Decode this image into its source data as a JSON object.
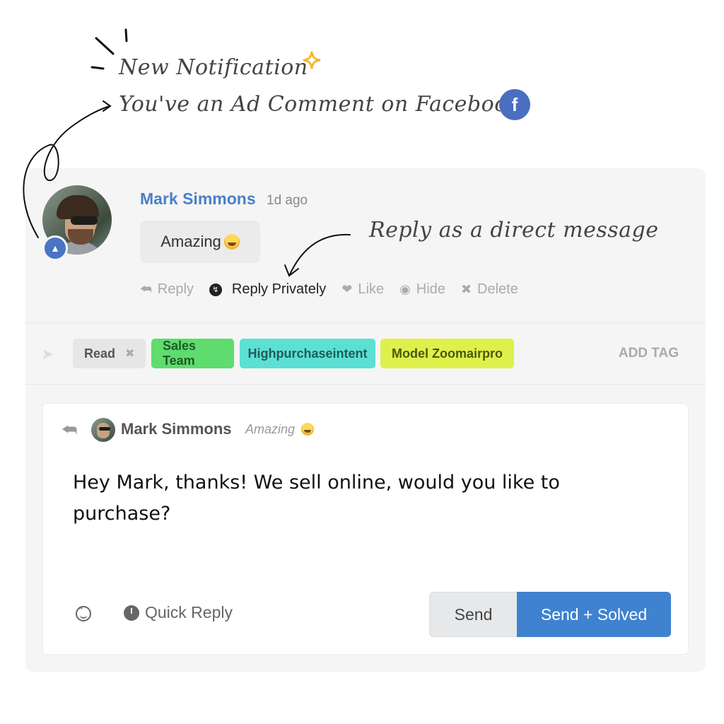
{
  "annotation": {
    "title": "New Notification",
    "subtitle": "You've an Ad Comment on Facebook",
    "platform_badge": "f",
    "reply_hint": "Reply as a direct message"
  },
  "comment": {
    "author": "Mark Simmons",
    "time_ago": "1d ago",
    "text": "Amazing",
    "emoji_icon": "star-struck-emoji",
    "avatar_badge_icon": "megaphone-icon",
    "actions": [
      {
        "label": "Reply",
        "icon": "reply-arrow-icon"
      },
      {
        "label": "Reply Privately",
        "icon": "messenger-icon"
      },
      {
        "label": "Like",
        "icon": "heart-icon"
      },
      {
        "label": "Hide",
        "icon": "eye-slash-icon"
      },
      {
        "label": "Delete",
        "icon": "x-icon"
      }
    ]
  },
  "tags": {
    "icon": "tag-icon",
    "items": [
      {
        "label": "Read",
        "removable": true,
        "color": "#e6e6e6"
      },
      {
        "label": "Sales Team",
        "color": "#5edc6e"
      },
      {
        "label": "Highpurchaseintent",
        "color": "#5ce0d4"
      },
      {
        "label": "Model Zoomairpro",
        "color": "#def04a"
      }
    ],
    "remove_glyph": "✖",
    "add_label": "ADD TAG"
  },
  "reply": {
    "to_author": "Mark Simmons",
    "quoted_text": "Amazing",
    "message": "Hey Mark, thanks! We sell online, would you like to purchase?",
    "quick_reply_label": "Quick Reply",
    "send_label": "Send",
    "send_solved_label": "Send + Solved"
  },
  "colors": {
    "accent": "#3f82d0",
    "author_name": "#4a80c8",
    "facebook": "#4a6fc1"
  }
}
